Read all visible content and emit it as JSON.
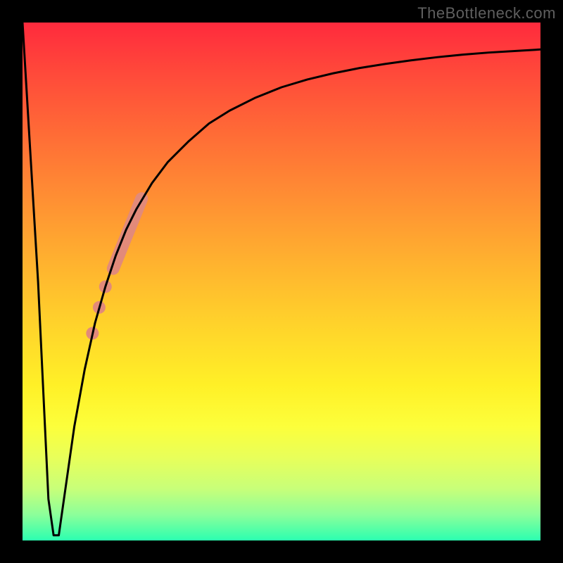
{
  "watermark": "TheBottleneck.com",
  "chart_data": {
    "type": "line",
    "title": "",
    "xlabel": "",
    "ylabel": "",
    "xlim": [
      0,
      100
    ],
    "ylim": [
      0,
      100
    ],
    "background": "rainbow-gradient-red-to-green-vertical",
    "series": [
      {
        "name": "bottleneck-curve",
        "color": "#000000",
        "stroke_width": 3,
        "x": [
          0,
          3,
          5,
          6,
          7,
          8,
          10,
          12,
          14,
          16,
          18,
          20,
          22,
          25,
          28,
          32,
          36,
          40,
          45,
          50,
          55,
          60,
          65,
          70,
          75,
          80,
          85,
          90,
          95,
          100
        ],
        "values": [
          100,
          50,
          8,
          1,
          1,
          8,
          22,
          33,
          42,
          49,
          55,
          60,
          64,
          69,
          73,
          77,
          80.5,
          83,
          85.5,
          87.5,
          89,
          90.2,
          91.2,
          92,
          92.7,
          93.3,
          93.8,
          94.2,
          94.5,
          94.8
        ]
      }
    ],
    "markers": [
      {
        "name": "highlight-segment",
        "color": "#e28a7a",
        "shape": "round-thick-line",
        "width": 18,
        "x_start": 17.5,
        "x_end": 23.0,
        "y_start": 52.5,
        "y_end": 66.0
      },
      {
        "name": "dot-1",
        "color": "#e28a7a",
        "shape": "circle",
        "r": 9,
        "x": 16.0,
        "y": 49.0
      },
      {
        "name": "dot-2",
        "color": "#e28a7a",
        "shape": "circle",
        "r": 9,
        "x": 14.8,
        "y": 45.0
      },
      {
        "name": "dot-3",
        "color": "#e28a7a",
        "shape": "circle",
        "r": 9,
        "x": 13.5,
        "y": 40.0
      }
    ]
  }
}
